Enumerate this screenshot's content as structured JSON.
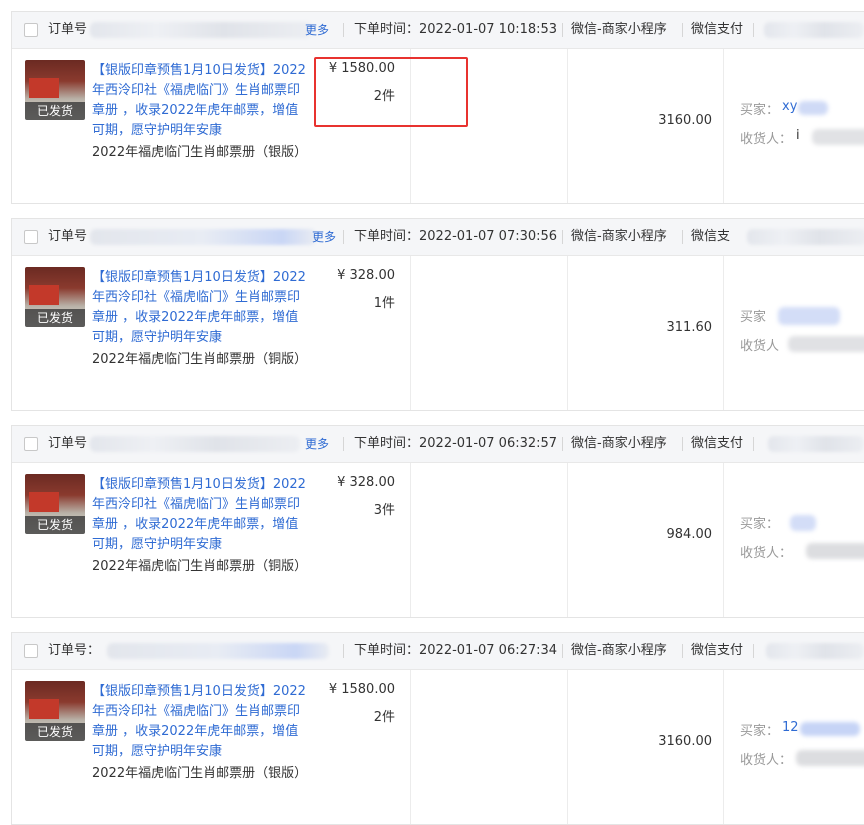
{
  "labels": {
    "order_no": "订单号：",
    "more": "更多",
    "buyer": "买家：",
    "buyer_alt": "买家",
    "receiver": "收货人：",
    "receiver_alt": "收货人",
    "shipped": "已发货"
  },
  "orders": [
    {
      "order_no_prefix": "订单号",
      "more": "更多",
      "time": "下单时间：2022-01-07 10:18:53",
      "source": "微信-商家小程序",
      "payment": "微信支付",
      "status_tag": "已发货",
      "title": "【银版印章预售1月10日发货】2022年西泠印社《福虎临门》生肖邮票印章册 ，收录2022年虎年邮票，增值可期，愿守护明年安康",
      "sku": "2022年福虎临门生肖邮票册（银版）",
      "price": "¥ 1580.00",
      "qty": "2件",
      "total": "3160.00",
      "buyer_label": "买家：",
      "buyer_visible": "xy",
      "receiver_label": "收货人：",
      "receiver_visible": "i"
    },
    {
      "order_no_prefix": "订单号",
      "more": "更多",
      "time": "下单时间：2022-01-07 07:30:56",
      "source": "微信-商家小程序",
      "payment": "微信支",
      "status_tag": "已发货",
      "title": "【银版印章预售1月10日发货】2022年西泠印社《福虎临门》生肖邮票印章册 ，收录2022年虎年邮票，增值可期，愿守护明年安康",
      "sku": "2022年福虎临门生肖邮票册（铜版）",
      "price": "¥ 328.00",
      "qty": "1件",
      "total": "311.60",
      "buyer_label": "买家",
      "buyer_visible": "",
      "receiver_label": "收货人",
      "receiver_visible": ""
    },
    {
      "order_no_prefix": "订单号",
      "more": "更多",
      "time": "下单时间：2022-01-07 06:32:57",
      "source": "微信-商家小程序",
      "payment": "微信支付",
      "status_tag": "已发货",
      "title": "【银版印章预售1月10日发货】2022年西泠印社《福虎临门》生肖邮票印章册 ，收录2022年虎年邮票，增值可期，愿守护明年安康",
      "sku": "2022年福虎临门生肖邮票册（铜版）",
      "price": "¥ 328.00",
      "qty": "3件",
      "total": "984.00",
      "buyer_label": "买家：",
      "buyer_visible": "",
      "receiver_label": "收货人：",
      "receiver_visible": ""
    },
    {
      "order_no_prefix": "订单号：",
      "more": "",
      "time": "下单时间：2022-01-07 06:27:34",
      "source": "微信-商家小程序",
      "payment": "微信支付",
      "status_tag": "已发货",
      "title": "【银版印章预售1月10日发货】2022年西泠印社《福虎临门》生肖邮票印章册 ，收录2022年虎年邮票，增值可期，愿守护明年安康",
      "sku": "2022年福虎临门生肖邮票册（银版）",
      "price": "¥ 1580.00",
      "qty": "2件",
      "total": "3160.00",
      "buyer_label": "买家：",
      "buyer_visible": "12",
      "receiver_label": "收货人：",
      "receiver_visible": ""
    }
  ],
  "highlight_color": "#e8322f",
  "link_color": "#2f6bd3"
}
